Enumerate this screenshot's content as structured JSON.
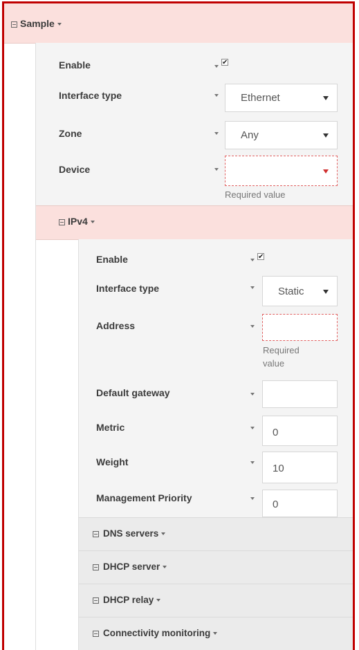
{
  "sample": {
    "title": "Sample",
    "fields": {
      "enable_label": "Enable",
      "enable_checked": true,
      "interface_type_label": "Interface type",
      "interface_type_value": "Ethernet",
      "zone_label": "Zone",
      "zone_value": "Any",
      "device_label": "Device",
      "device_value": "",
      "device_error": "Required value"
    }
  },
  "ipv4": {
    "title": "IPv4",
    "fields": {
      "enable_label": "Enable",
      "enable_checked": true,
      "interface_type_label": "Interface type",
      "interface_type_value": "Static",
      "address_label": "Address",
      "address_value": "",
      "address_error_line1": "Required",
      "address_error_line2": "value",
      "gateway_label": "Default gateway",
      "gateway_value": "",
      "metric_label": "Metric",
      "metric_value": "0",
      "weight_label": "Weight",
      "weight_value": "10",
      "mgmt_priority_label": "Management Priority",
      "mgmt_priority_value": "0"
    },
    "subsections": {
      "dns": "DNS servers",
      "dhcp_server": "DHCP server",
      "dhcp_relay": "DHCP relay",
      "connectivity": "Connectivity monitoring"
    }
  }
}
